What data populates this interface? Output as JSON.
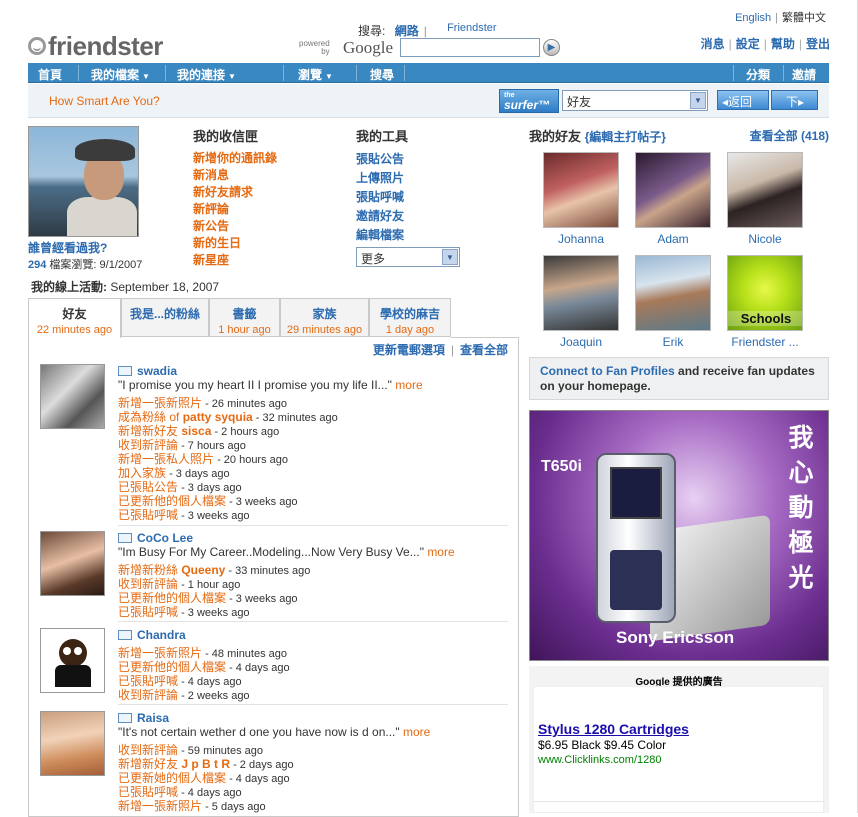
{
  "lang": {
    "english": "English",
    "chinese": "繁體中文"
  },
  "logo": "friendster",
  "search": {
    "label": "搜尋:",
    "web": "網路",
    "friendster": "Friendster",
    "powered": "powered by",
    "google": "Google",
    "value": ""
  },
  "toplinks": [
    "消息",
    "設定",
    "幫助",
    "登出"
  ],
  "nav": {
    "home": "首頁",
    "profile": "我的檔案",
    "connections": "我的連接",
    "browse": "瀏覽",
    "search": "搜尋",
    "classifieds": "分類",
    "invite": "邀請"
  },
  "subbar": {
    "smart": "How Smart Are You?",
    "surfer_the": "the",
    "surfer": "surfer™",
    "select": "好友",
    "back": "◂返回",
    "next": "下▸"
  },
  "profile": {
    "whosaw": "誰曾經看過我?",
    "views_count": "294",
    "views_label": "檔案瀏覽: 9/1/2007",
    "lastact_label": "我的線上活動:",
    "lastact_date": "September 18, 2007"
  },
  "inbox": {
    "title": "我的收信匣",
    "items": [
      "新增你的通訊錄",
      "新消息",
      "新好友請求",
      "新評論",
      "新公告",
      "新的生日",
      "新星座"
    ]
  },
  "tools": {
    "title": "我的工具",
    "items": [
      "張貼公告",
      "上傳照片",
      "張貼呼喊",
      "邀請好友",
      "編輯檔案"
    ],
    "more": "更多"
  },
  "tabs": [
    {
      "t": "好友",
      "s": "22 minutes ago"
    },
    {
      "t": "我是...的粉絲",
      "s": ""
    },
    {
      "t": "書籤",
      "s": "1 hour ago"
    },
    {
      "t": "家族",
      "s": "29 minutes ago"
    },
    {
      "t": "學校的麻吉",
      "s": "1 day ago"
    }
  ],
  "feedlinks": {
    "email": "更新電郵選項",
    "all": "查看全部"
  },
  "feed": [
    {
      "name": "swadia",
      "quote": "\"I promise you my heart II I promise you my life II...\"",
      "more": "more",
      "lines": [
        {
          "act": "新增一張新照片",
          "who": "",
          "time": " - 26 minutes ago"
        },
        {
          "act": "成為粉絲 of ",
          "who": "patty syquia",
          "time": " - 32 minutes ago"
        },
        {
          "act": "新增新好友 ",
          "who": "sisca",
          "time": " - 2 hours ago"
        },
        {
          "act": "收到新評論",
          "who": "",
          "time": " - 7 hours ago"
        },
        {
          "act": "新增一張私人照片",
          "who": "",
          "time": " - 20 hours ago"
        },
        {
          "act": "加入家族",
          "who": "",
          "time": " - 3 days ago"
        },
        {
          "act": "已張貼公告",
          "who": "",
          "time": " - 3 days ago"
        },
        {
          "act": "已更新他的個人檔案",
          "who": "",
          "time": " - 3 weeks ago"
        },
        {
          "act": "已張貼呼喊",
          "who": "",
          "time": " - 3 weeks ago"
        }
      ]
    },
    {
      "name": "CoCo Lee",
      "quote": "\"Im Busy For My Career..Modeling...Now Very Busy Ve...\"",
      "more": "more",
      "lines": [
        {
          "act": "新增新粉絲 ",
          "who": "Queeny",
          "time": " - 33 minutes ago"
        },
        {
          "act": "收到新評論",
          "who": "",
          "time": " - 1 hour ago"
        },
        {
          "act": "已更新他的個人檔案",
          "who": "",
          "time": " - 3 weeks ago"
        },
        {
          "act": "已張貼呼喊",
          "who": "",
          "time": " - 3 weeks ago"
        }
      ]
    },
    {
      "name": "Chandra",
      "quote": "",
      "more": "",
      "lines": [
        {
          "act": "新增一張新照片",
          "who": "",
          "time": " - 48 minutes ago"
        },
        {
          "act": "已更新他的個人檔案",
          "who": "",
          "time": " - 4 days ago"
        },
        {
          "act": "已張貼呼喊",
          "who": "",
          "time": " - 4 days ago"
        },
        {
          "act": "收到新評論",
          "who": "",
          "time": " - 2 weeks ago"
        }
      ]
    },
    {
      "name": "Raisa",
      "quote": "\"It's not certain wether d one you have now is d on...\"",
      "more": "more",
      "lines": [
        {
          "act": "收到新評論",
          "who": "",
          "time": " - 59 minutes ago"
        },
        {
          "act": "新增新好友 ",
          "who": "J p B t R",
          "time": " - 2 days ago"
        },
        {
          "act": "已更新她的個人檔案",
          "who": "",
          "time": " - 4 days ago"
        },
        {
          "act": "已張貼呼喊",
          "who": "",
          "time": " - 4 days ago"
        },
        {
          "act": "新增一張新照片",
          "who": "",
          "time": " - 5 days ago"
        }
      ]
    }
  ],
  "friends": {
    "title": "我的好友",
    "edit": "{編輯主打帖子}",
    "viewall": "查看全部 (418)",
    "list": [
      "Johanna",
      "Adam",
      "Nicole",
      "Joaquin",
      "Erik",
      "Friendster ..."
    ]
  },
  "fan": {
    "link": "Connect to Fan Profiles",
    "text": " and receive fan updates on your homepage."
  },
  "ad": {
    "model": "T650i",
    "cn": "我心動極光",
    "brand": "Sony Ericsson",
    "schools": "Schools"
  },
  "gads": {
    "title": "Google 提供的廣告",
    "headline": "Stylus 1280 Cartridges",
    "desc": "$6.95 Black $9.45 Color",
    "url": "www.Clicklinks.com/1280"
  }
}
